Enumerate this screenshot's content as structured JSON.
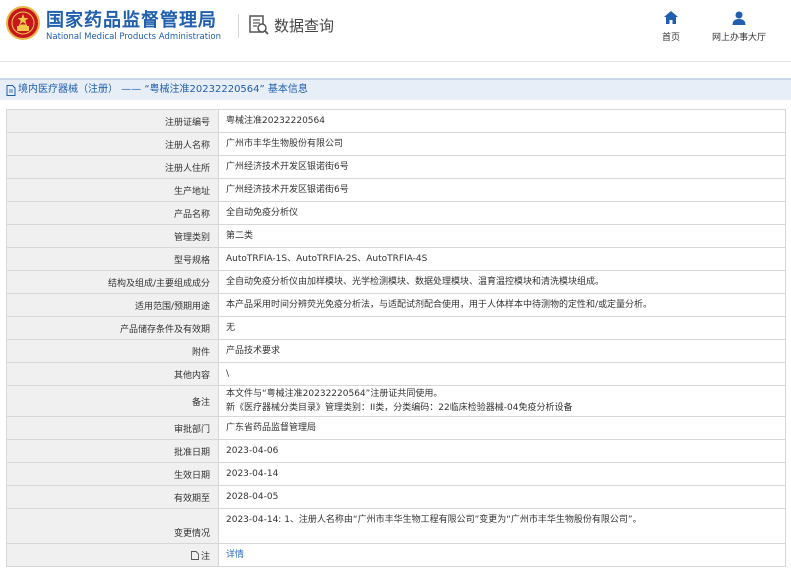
{
  "header": {
    "site_title": "国家药品监督管理局",
    "site_subtitle": "National Medical Products Administration",
    "query_label": "数据查询",
    "nav": [
      {
        "label": "首页",
        "icon": "home-icon"
      },
      {
        "label": "网上办事大厅",
        "icon": "user-icon"
      }
    ],
    "brand_color": "#1f5fae"
  },
  "breadcrumb": {
    "text": "境内医疗器械（注册） —— “粤械注准20232220564” 基本信息"
  },
  "rows": [
    {
      "label": "注册证编号",
      "value": "粤械注准20232220564"
    },
    {
      "label": "注册人名称",
      "value": "广州市丰华生物股份有限公司"
    },
    {
      "label": "注册人住所",
      "value": "广州经济技术开发区银诺街6号"
    },
    {
      "label": "生产地址",
      "value": "广州经济技术开发区银诺街6号"
    },
    {
      "label": "产品名称",
      "value": "全自动免疫分析仪"
    },
    {
      "label": "管理类别",
      "value": "第二类"
    },
    {
      "label": "型号规格",
      "value": "AutoTRFIA-1S、AutoTRFIA-2S、AutoTRFIA-4S"
    },
    {
      "label": "结构及组成/主要组成成分",
      "value": "全自动免疫分析仪由加样模块、光学检测模块、数据处理模块、温育温控模块和清洗模块组成。"
    },
    {
      "label": "适用范围/预期用途",
      "value": "本产品采用时间分辨荧光免疫分析法，与适配试剂配合使用，用于人体样本中待测物的定性和/或定量分析。"
    },
    {
      "label": "产品储存条件及有效期",
      "value": "无"
    },
    {
      "label": "附件",
      "value": "产品技术要求"
    },
    {
      "label": "其他内容",
      "value": "\\"
    },
    {
      "label": "备注",
      "value_lines": [
        "本文件与“粤械注准20232220564”注册证共同使用。",
        "新《医疗器械分类目录》管理类别：II类，分类编码：22临床检验器械-04免疫分析设备"
      ]
    },
    {
      "label": "审批部门",
      "value": "广东省药品监督管理局"
    },
    {
      "label": "批准日期",
      "value": "2023-04-06"
    },
    {
      "label": "生效日期",
      "value": "2023-04-14"
    },
    {
      "label": "有效期至",
      "value": "2028-04-05"
    },
    {
      "label": "变更情况",
      "value": "2023-04-14: 1、注册人名称由“广州市丰华生物工程有限公司”变更为“广州市丰华生物股份有限公司”。"
    },
    {
      "label": "注",
      "value": "详情",
      "label_icon": "document-icon"
    }
  ]
}
